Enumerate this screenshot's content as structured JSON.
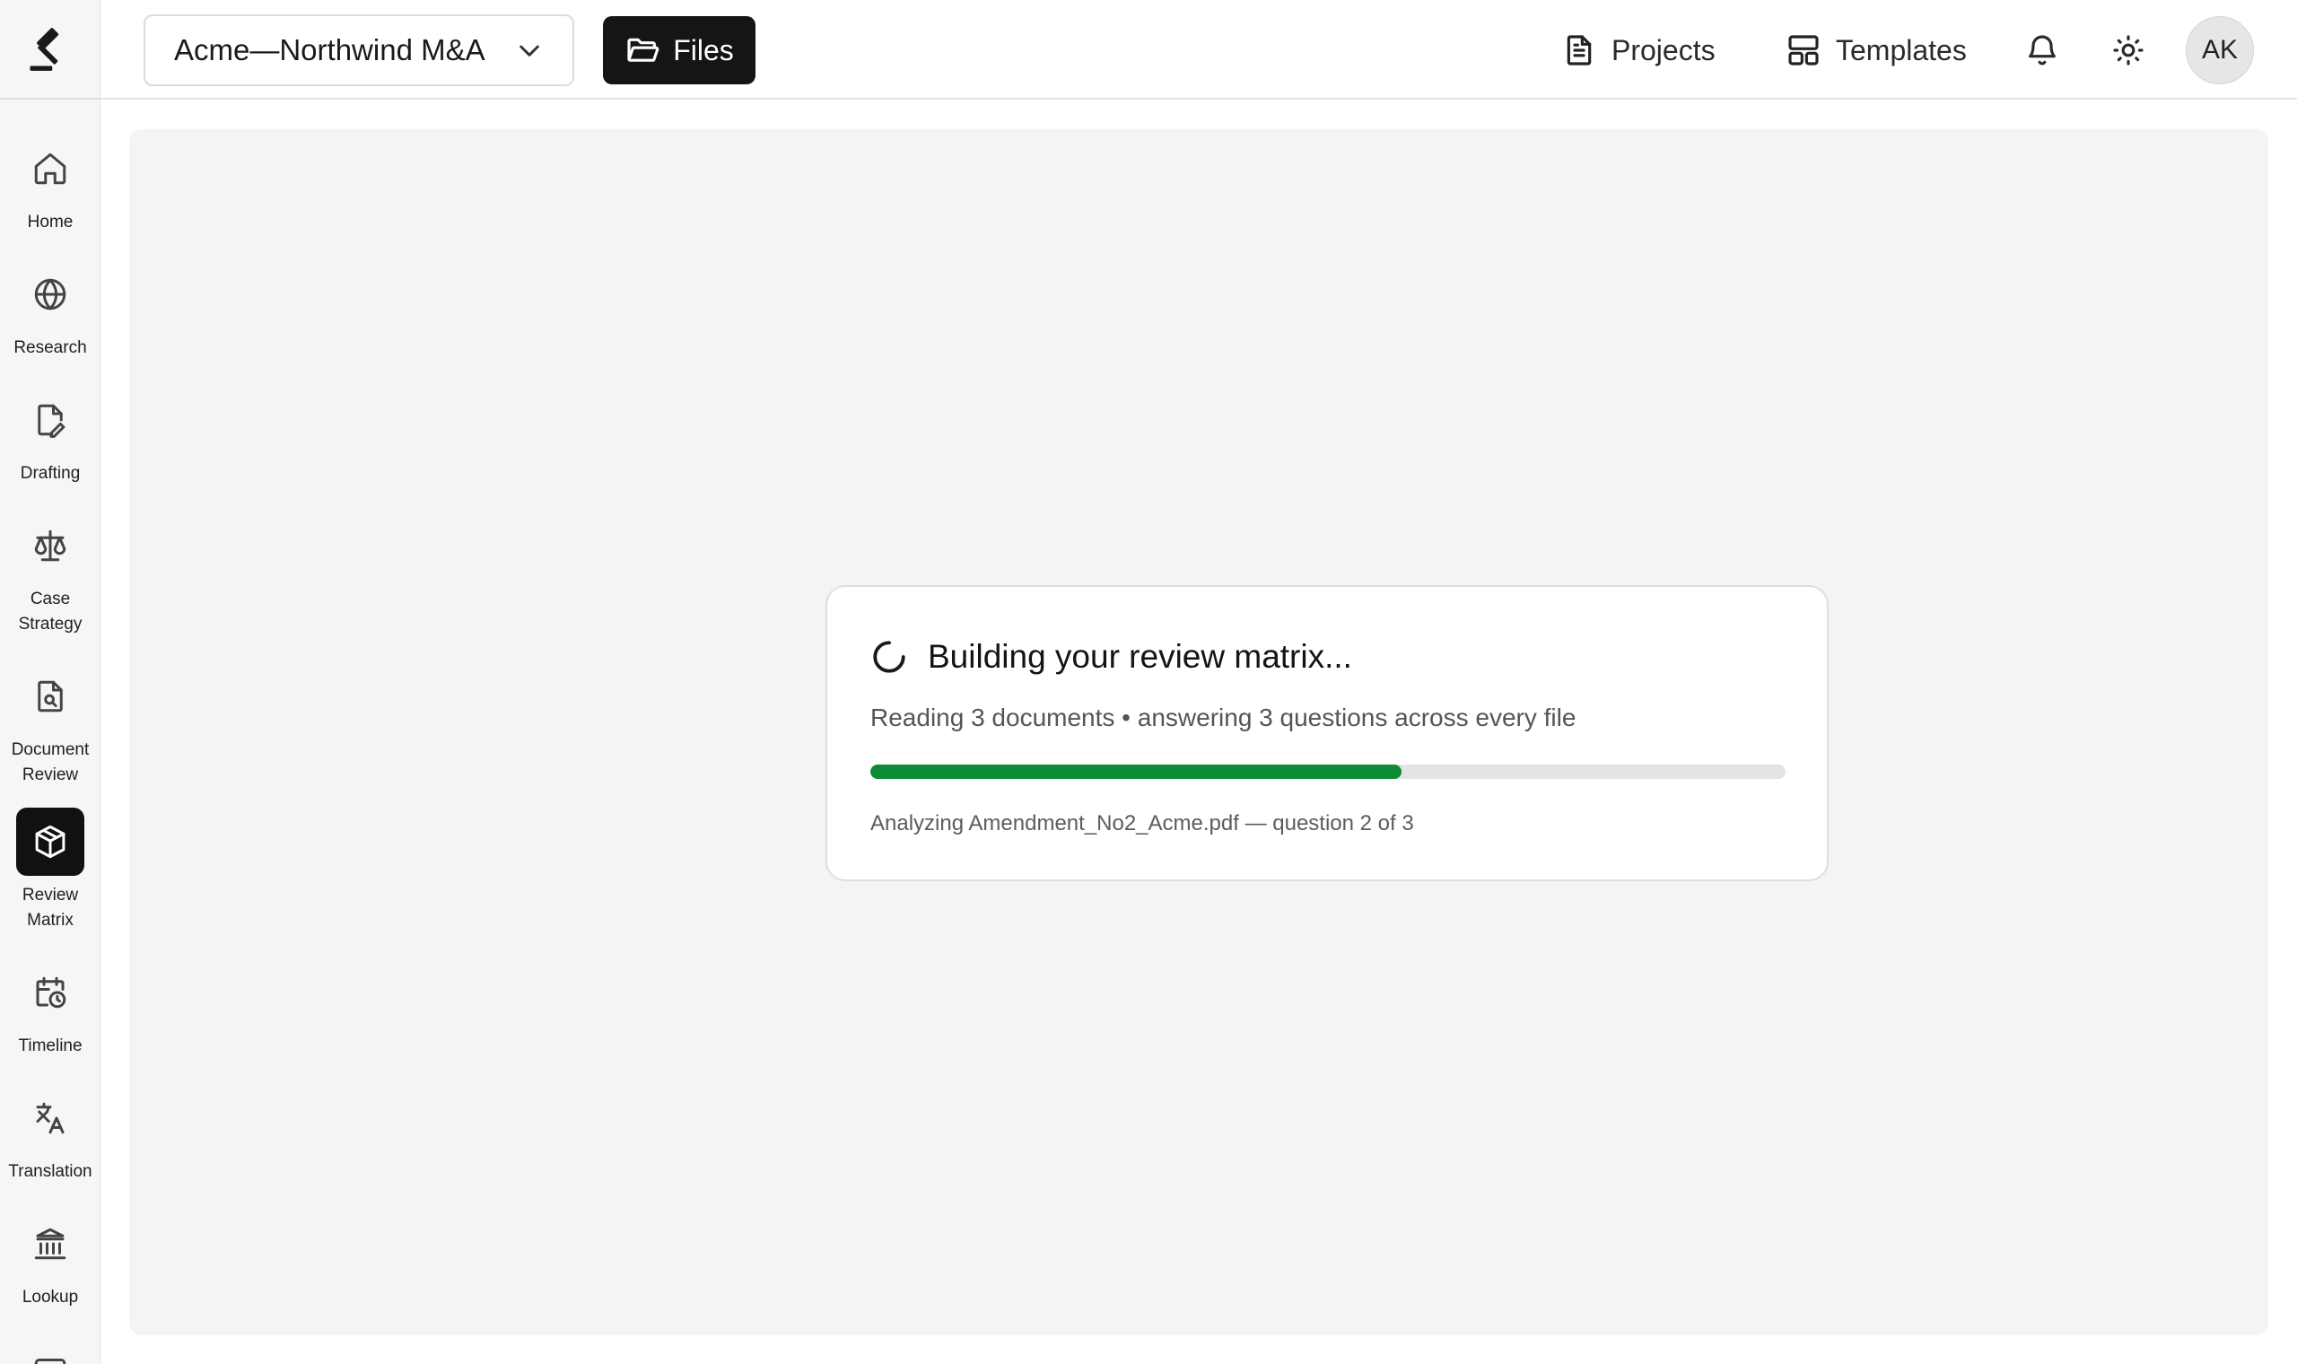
{
  "brand": {
    "logo_icon": "gavel-icon"
  },
  "sidebar": {
    "items": [
      {
        "label": "Home",
        "icon": "home-icon",
        "active": false
      },
      {
        "label": "Research",
        "icon": "globe-icon",
        "active": false
      },
      {
        "label": "Drafting",
        "icon": "file-pen-icon",
        "active": false
      },
      {
        "label": "Case\nStrategy",
        "icon": "scale-icon",
        "active": false
      },
      {
        "label": "Document\nReview",
        "icon": "file-search-icon",
        "active": false
      },
      {
        "label": "Review\nMatrix",
        "icon": "box-icon",
        "active": true
      },
      {
        "label": "Timeline",
        "icon": "calendar-clock-icon",
        "active": false
      },
      {
        "label": "Translation",
        "icon": "languages-icon",
        "active": false
      },
      {
        "label": "Lookup",
        "icon": "landmark-icon",
        "active": false
      }
    ]
  },
  "header": {
    "project_name": "Acme—Northwind M&A",
    "files_label": "Files",
    "projects_label": "Projects",
    "templates_label": "Templates",
    "avatar_initials": "AK"
  },
  "loading": {
    "title": "Building your review matrix...",
    "subtitle": "Reading 3 documents • answering 3 questions across every file",
    "progress_percent": 58,
    "status": "Analyzing Amendment_No2_Acme.pdf — question 2 of 3"
  },
  "colors": {
    "accent": "#111111",
    "progress": "#0c8a35",
    "content_bg": "#f4f4f4"
  }
}
